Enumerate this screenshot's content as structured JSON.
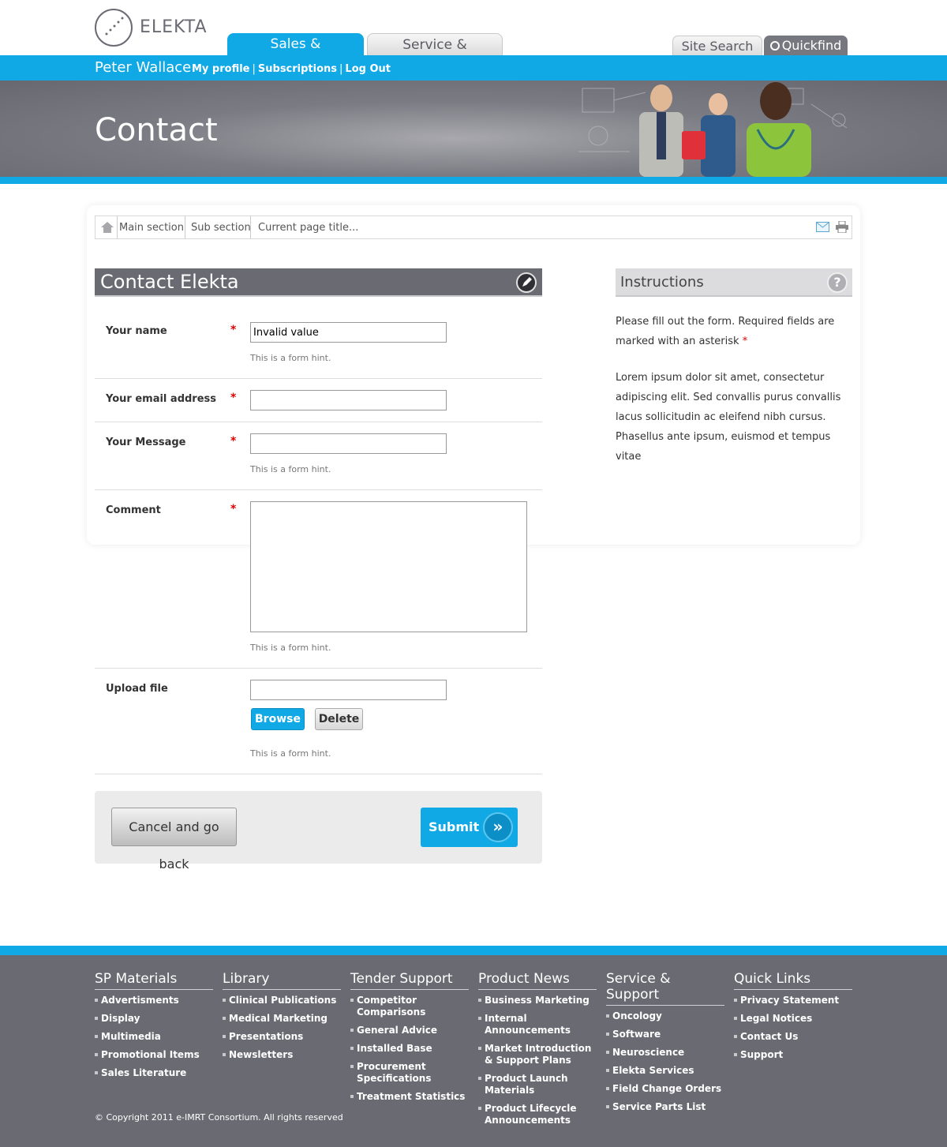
{
  "header": {
    "logo_text": "ELEKTA",
    "tabs": [
      {
        "label": "Sales & Marketing",
        "active": true
      },
      {
        "label": "Service & Support",
        "active": false
      }
    ],
    "site_search_label": "Site Search",
    "quickfind_label": "Quickfind"
  },
  "user": {
    "name": "Peter Wallace",
    "links": [
      "My profile",
      "Subscriptions",
      "Log Out"
    ]
  },
  "banner": {
    "title": "Contact"
  },
  "breadcrumb": {
    "items": [
      "Main section",
      "Sub section",
      "Current page title..."
    ]
  },
  "form": {
    "title": "Contact Elekta",
    "fields": [
      {
        "label": "Your name",
        "required_mark": "*",
        "value": "Invalid value",
        "hint": "This is a form hint."
      },
      {
        "label": "Your email address",
        "required_mark": "*",
        "value": "",
        "hint": ""
      },
      {
        "label": "Your Message",
        "required_mark": "*",
        "value": "",
        "hint": "This is a form hint."
      },
      {
        "label": "Comment",
        "required_mark": "*",
        "value": "",
        "hint": "This is a form hint."
      },
      {
        "label": "Upload file",
        "value": "",
        "hint": "This is a form hint."
      }
    ],
    "browse_label": "Browse",
    "delete_label": "Delete",
    "cancel_label": "Cancel and go back",
    "submit_label": "Submit"
  },
  "instructions": {
    "title": "Instructions",
    "text1": "Please fill out the form. Required fields are marked with an asterisk",
    "asterisk": "*",
    "text2": "Lorem ipsum dolor sit amet, consectetur adipiscing elit. Sed convallis purus convallis lacus sollicitudin ac eleifend nibh cursus. Phasellus ante ipsum, euismod et tempus vitae"
  },
  "footer": {
    "columns": [
      {
        "title": "SP Materials",
        "items": [
          "Advertisments",
          "Display",
          "Multimedia",
          "Promotional Items",
          "Sales Literature"
        ]
      },
      {
        "title": "Library",
        "items": [
          "Clinical Publications",
          "Medical Marketing",
          "Presentations",
          "Newsletters"
        ]
      },
      {
        "title": "Tender Support",
        "items": [
          "Competitor Comparisons",
          "General Advice",
          "Installed Base",
          "Procurement Specifications",
          "Treatment Statistics"
        ]
      },
      {
        "title": "Product News",
        "items": [
          "Business Marketing",
          "Internal Announcements",
          "Market Introduction & Support Plans",
          "Product Launch Materials",
          "Product Lifecycle Announcements"
        ]
      },
      {
        "title": "Service & Support",
        "items": [
          "Oncology",
          "Software",
          "Neuroscience",
          "Elekta Services",
          "Field Change Orders",
          "Service Parts List"
        ]
      },
      {
        "title": "Quick Links",
        "items": [
          "Privacy Statement",
          "Legal Notices",
          "Contact Us",
          "Support"
        ]
      }
    ],
    "copyright": "© Copyright 2011 e-IMRT Consortium. All rights reserved"
  },
  "colors": {
    "accent": "#11a9e5",
    "dark_gray": "#6a6a72",
    "required": "#dd0000"
  }
}
